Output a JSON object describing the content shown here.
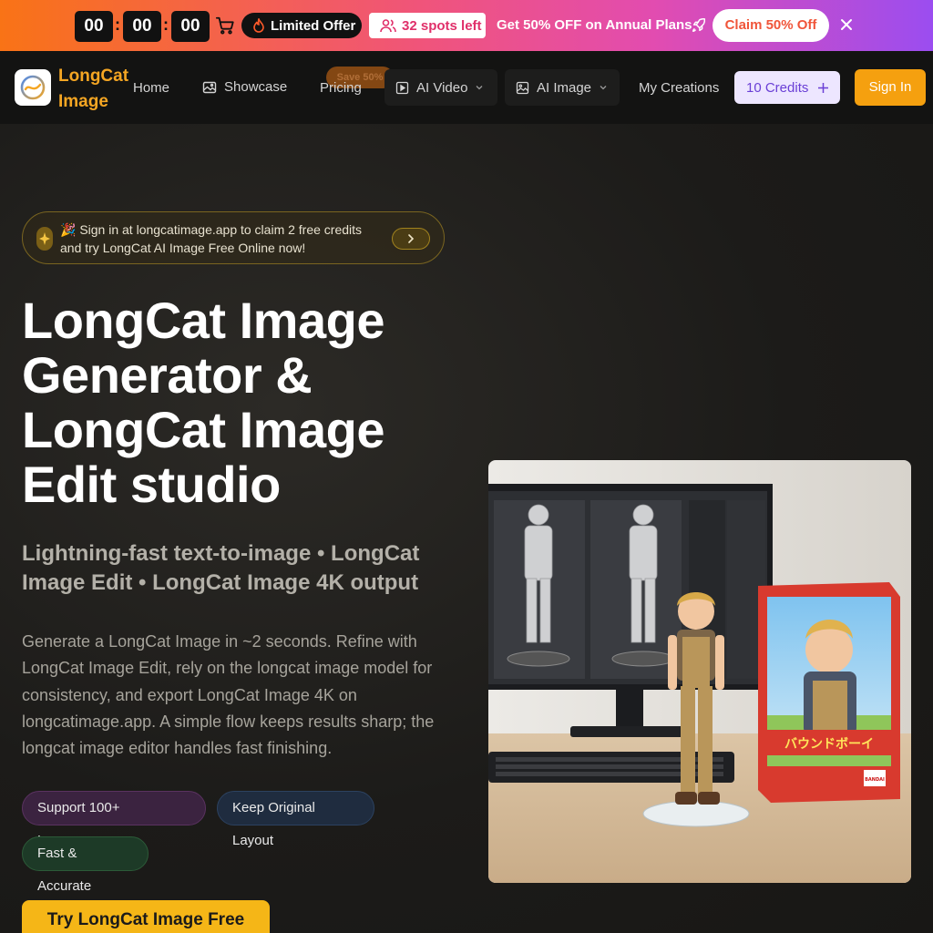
{
  "promo": {
    "timer": {
      "hours": "00",
      "minutes": "00",
      "seconds": "00",
      "separator": ":"
    },
    "limited_label": "Limited Offer",
    "spots_label": "32 spots left",
    "offer_text": "Get 50% OFF on Annual Plans",
    "claim_label": "Claim 50% Off",
    "colors": {
      "start": "#f97316",
      "end": "#9b4df0"
    }
  },
  "nav": {
    "brand_line1": "LongCat",
    "brand_line2": "Image",
    "home": "Home",
    "showcase": "Showcase",
    "pricing": "Pricing",
    "save_badge": "Save 50%",
    "ai_video": "AI Video",
    "ai_image": "AI Image",
    "my_creations": "My Creations",
    "credits": "10 Credits",
    "sign_in": "Sign In",
    "accent": "#f5a623"
  },
  "hero": {
    "announcement": "🎉 Sign in at longcatimage.app to claim 2 free credits and try LongCat AI Image Free Online now!",
    "title": "LongCat Image Generator & LongCat Image Edit studio",
    "subtitle": "Lightning-fast text-to-image • LongCat Image Edit • LongCat Image 4K output",
    "description": "Generate a LongCat Image in ~2 seconds. Refine with LongCat Image Edit, rely on the longcat image model for consistency, and export LongCat Image 4K on longcatimage.app. A simple flow keeps results sharp; the longcat image editor handles fast finishing.",
    "chips": [
      "Support 100+ Languages",
      "Keep Original Layout",
      "Fast & Accurate"
    ],
    "cta": "Try LongCat Image Free",
    "box_text_title": "バウンドボーイ",
    "box_logo": "BANDAI"
  }
}
